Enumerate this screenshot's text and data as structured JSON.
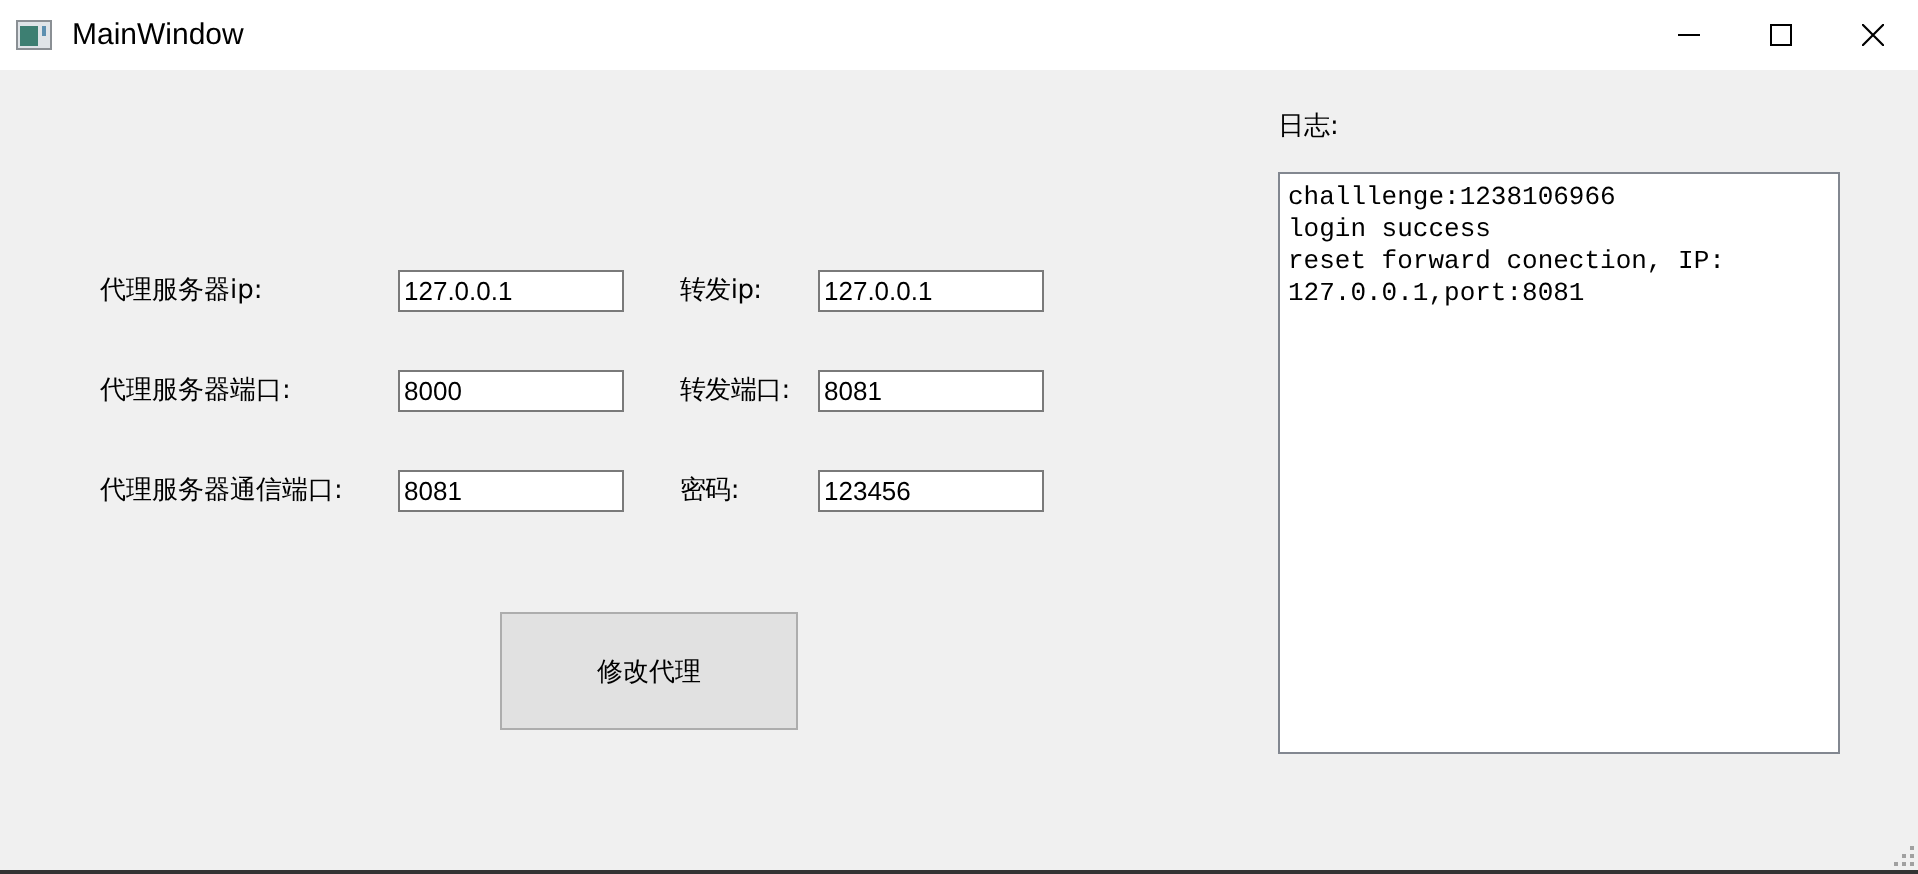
{
  "window": {
    "title": "MainWindow"
  },
  "fields": [
    {
      "label": "代理服务器ip:",
      "value": "127.0.0.1"
    },
    {
      "label": "转发ip:",
      "value": "127.0.0.1"
    },
    {
      "label": "代理服务器端口:",
      "value": "8000"
    },
    {
      "label": "转发端口:",
      "value": "8081"
    },
    {
      "label": "代理服务器通信端口:",
      "value": "8081"
    },
    {
      "label": "密码:",
      "value": "123456"
    }
  ],
  "button": "修改代理",
  "log": {
    "label": "日志:",
    "lines": [
      "challlenge:1238106966",
      "login success",
      "reset forward conection, IP:",
      "127.0.0.1,port:8081"
    ]
  }
}
